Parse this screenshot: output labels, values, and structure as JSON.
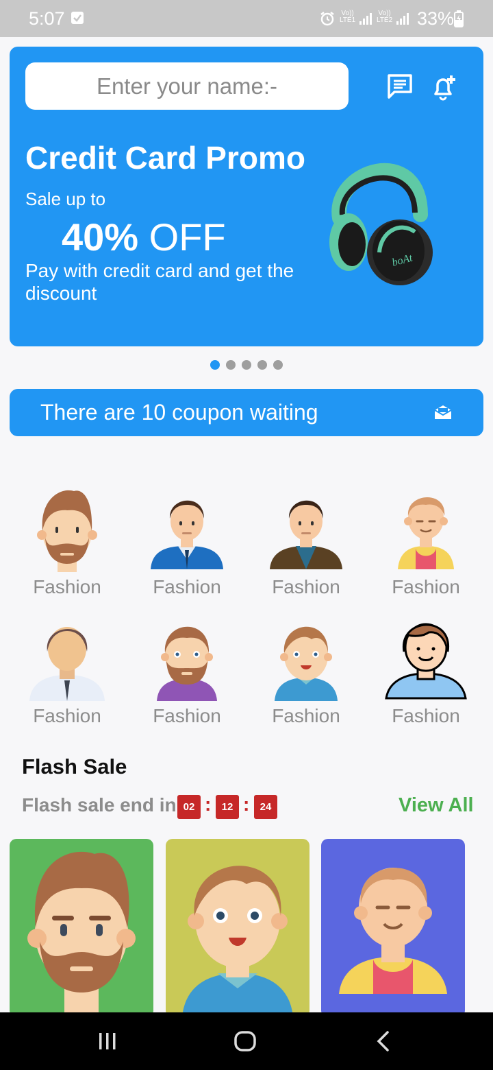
{
  "status_bar": {
    "time": "5:07",
    "net1": "Vo))\nLTE1",
    "net2": "Vo))\nLTE2",
    "battery": "33%"
  },
  "header": {
    "search_placeholder": "Enter your name:-",
    "icons": [
      "message-icon",
      "notification-add-icon"
    ]
  },
  "banner": {
    "title": "Credit Card Promo",
    "subtitle": "Sale up to",
    "discount_value": "40%",
    "discount_word": "OFF",
    "description": "Pay with credit card and get the discount",
    "brand_on_product": "boAt",
    "carousel_pages": 5,
    "carousel_active": 0
  },
  "coupon": {
    "text": "There are 10 coupon waiting",
    "icon": "mail-open-icon"
  },
  "categories": [
    {
      "label": "Fashion"
    },
    {
      "label": "Fashion"
    },
    {
      "label": "Fashion"
    },
    {
      "label": "Fashion"
    },
    {
      "label": "Fashion"
    },
    {
      "label": "Fashion"
    },
    {
      "label": "Fashion"
    },
    {
      "label": "Fashion"
    }
  ],
  "flash_sale": {
    "title": "Flash Sale",
    "ends_label": "Flash sale end in",
    "hours": "02",
    "minutes": "12",
    "seconds": "24",
    "view_all": "View All",
    "cards": [
      {
        "bg": "#5cb85c"
      },
      {
        "bg": "#c9c957"
      },
      {
        "bg": "#5b67e0"
      }
    ]
  },
  "colors": {
    "primary": "#2196f3",
    "timer": "#c62828",
    "view_all": "#4caf50"
  }
}
